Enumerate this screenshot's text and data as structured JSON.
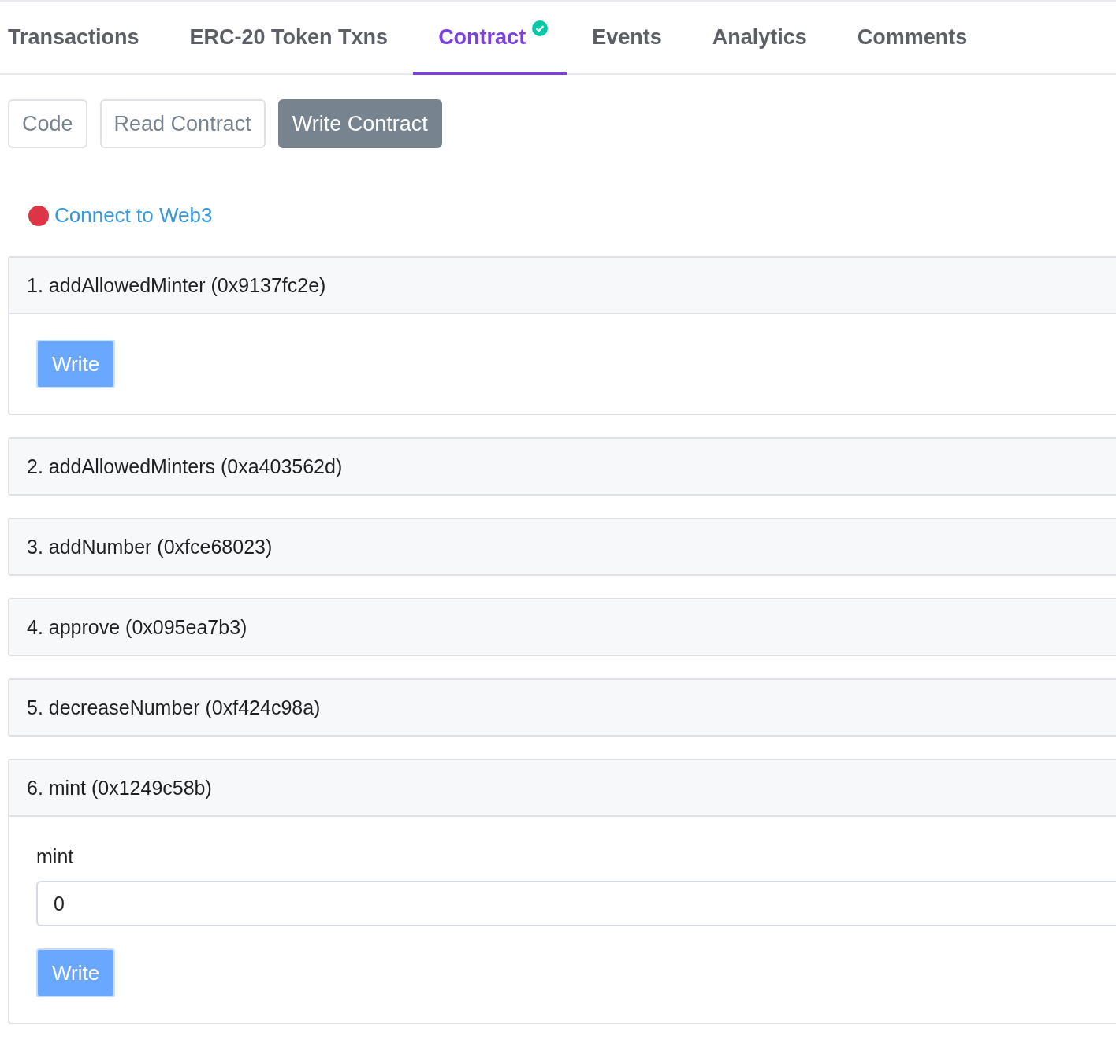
{
  "tabs": [
    {
      "label": "Transactions",
      "selected": false,
      "verified": false
    },
    {
      "label": "ERC-20 Token Txns",
      "selected": false,
      "verified": false
    },
    {
      "label": "Contract",
      "selected": true,
      "verified": true
    },
    {
      "label": "Events",
      "selected": false,
      "verified": false
    },
    {
      "label": "Analytics",
      "selected": false,
      "verified": false
    },
    {
      "label": "Comments",
      "selected": false,
      "verified": false
    }
  ],
  "subtabs": [
    {
      "label": "Code",
      "selected": false
    },
    {
      "label": "Read Contract",
      "selected": false
    },
    {
      "label": "Write Contract",
      "selected": true
    }
  ],
  "connect": {
    "label": "Connect to Web3",
    "connected": false
  },
  "functions": [
    {
      "title": "1. addAllowedMinter (0x9137fc2e)",
      "expanded": true,
      "button": "Write"
    },
    {
      "title": "2. addAllowedMinters (0xa403562d)",
      "expanded": false
    },
    {
      "title": "3. addNumber (0xfce68023)",
      "expanded": false
    },
    {
      "title": "4. approve (0x095ea7b3)",
      "expanded": false
    },
    {
      "title": "5. decreaseNumber (0xf424c98a)",
      "expanded": false
    },
    {
      "title": "6. mint (0x1249c58b)",
      "expanded": true,
      "inputs": [
        {
          "label": "mint",
          "value": "0"
        }
      ],
      "button": "Write"
    }
  ]
}
